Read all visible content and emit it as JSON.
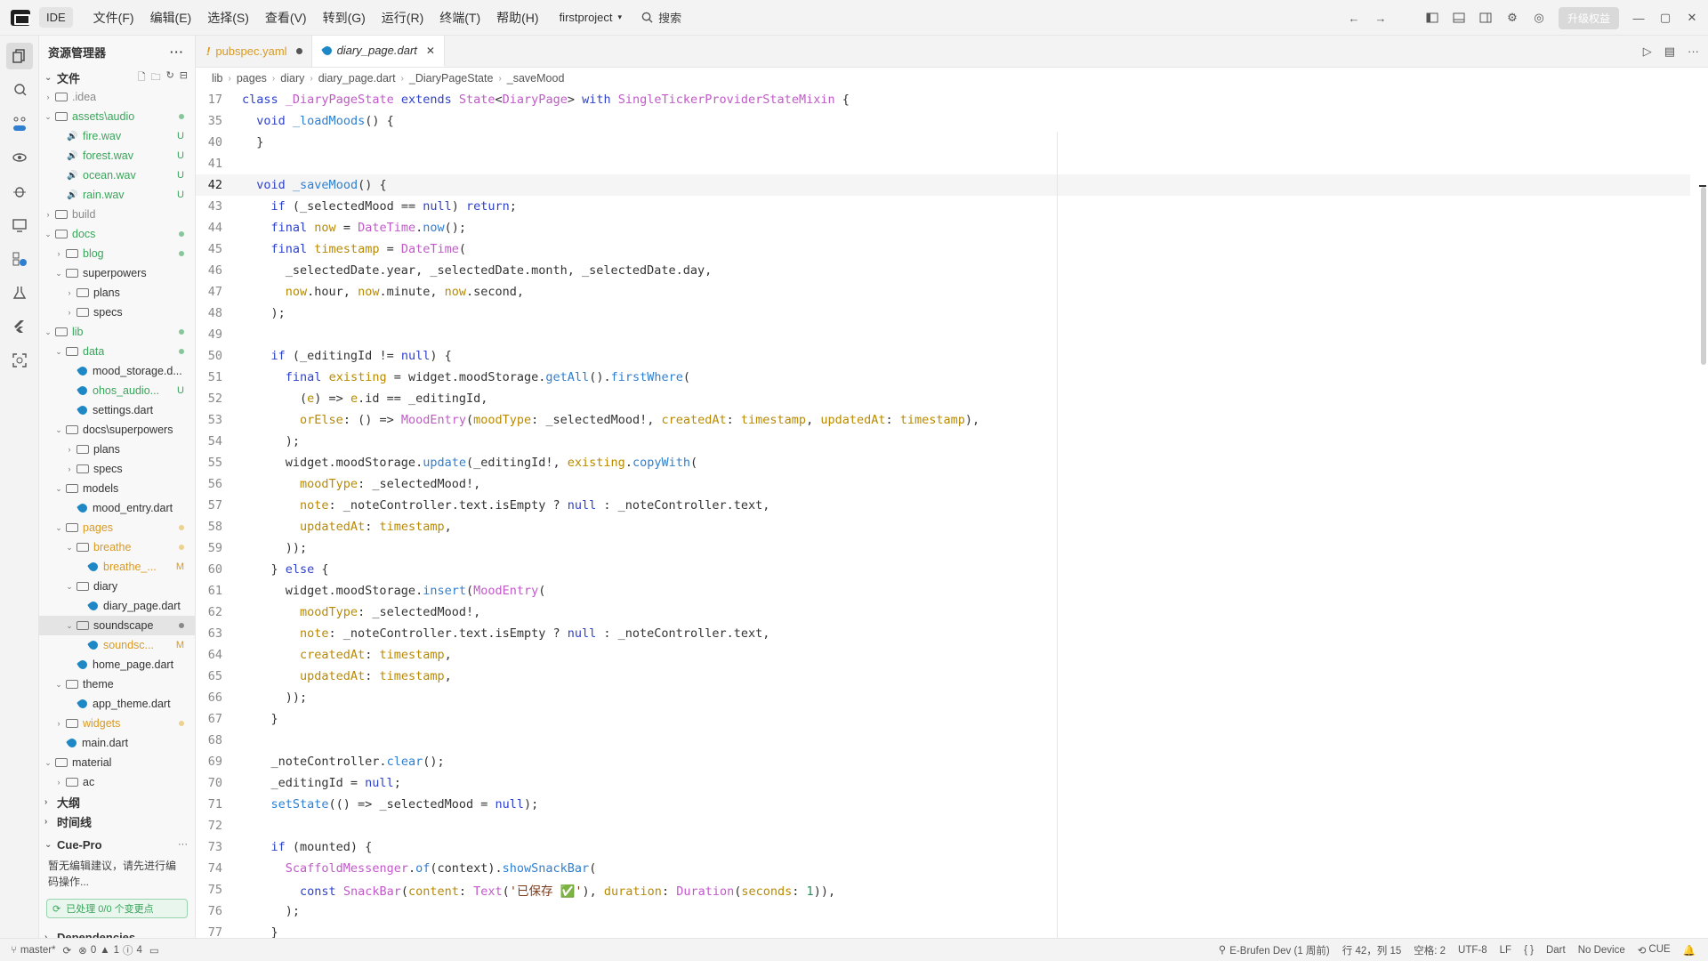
{
  "titlebar": {
    "app": "IDE",
    "menus": [
      "文件(F)",
      "编辑(E)",
      "选择(S)",
      "查看(V)",
      "转到(G)",
      "运行(R)",
      "终端(T)",
      "帮助(H)"
    ],
    "project": "firstproject",
    "search": "搜索",
    "upgrade": "升级权益"
  },
  "sidebar": {
    "title": "资源管理器",
    "files_section": "文件",
    "tree": [
      {
        "depth": 0,
        "type": "folder",
        "label": ".idea",
        "open": false,
        "color": "gray"
      },
      {
        "depth": 0,
        "type": "folder",
        "label": "assets\\audio",
        "open": true,
        "color": "green",
        "dot": "green"
      },
      {
        "depth": 1,
        "type": "wav",
        "label": "fire.wav",
        "color": "green",
        "badge": "U"
      },
      {
        "depth": 1,
        "type": "wav",
        "label": "forest.wav",
        "color": "green",
        "badge": "U"
      },
      {
        "depth": 1,
        "type": "wav",
        "label": "ocean.wav",
        "color": "green",
        "badge": "U"
      },
      {
        "depth": 1,
        "type": "wav",
        "label": "rain.wav",
        "color": "green",
        "badge": "U"
      },
      {
        "depth": 0,
        "type": "folder",
        "label": "build",
        "open": false,
        "color": "gray"
      },
      {
        "depth": 0,
        "type": "folder",
        "label": "docs",
        "open": true,
        "color": "green",
        "dot": "green"
      },
      {
        "depth": 1,
        "type": "folder",
        "label": "blog",
        "open": false,
        "color": "green",
        "dot": "green"
      },
      {
        "depth": 1,
        "type": "folder",
        "label": "superpowers",
        "open": true,
        "color": "default"
      },
      {
        "depth": 2,
        "type": "folder",
        "label": "plans",
        "open": false,
        "color": "default"
      },
      {
        "depth": 2,
        "type": "folder",
        "label": "specs",
        "open": false,
        "color": "default"
      },
      {
        "depth": 0,
        "type": "folder",
        "label": "lib",
        "open": true,
        "color": "green",
        "dot": "green"
      },
      {
        "depth": 1,
        "type": "folder",
        "label": "data",
        "open": true,
        "color": "green",
        "dot": "green"
      },
      {
        "depth": 2,
        "type": "dart",
        "label": "mood_storage.d...",
        "color": "default"
      },
      {
        "depth": 2,
        "type": "dart",
        "label": "ohos_audio...",
        "color": "green",
        "badge": "U"
      },
      {
        "depth": 2,
        "type": "dart",
        "label": "settings.dart",
        "color": "default"
      },
      {
        "depth": 1,
        "type": "folder",
        "label": "docs\\superpowers",
        "open": true,
        "color": "default"
      },
      {
        "depth": 2,
        "type": "folder",
        "label": "plans",
        "open": false,
        "color": "default"
      },
      {
        "depth": 2,
        "type": "folder",
        "label": "specs",
        "open": false,
        "color": "default"
      },
      {
        "depth": 1,
        "type": "folder",
        "label": "models",
        "open": true,
        "color": "default"
      },
      {
        "depth": 2,
        "type": "dart",
        "label": "mood_entry.dart",
        "color": "default"
      },
      {
        "depth": 1,
        "type": "folder",
        "label": "pages",
        "open": true,
        "color": "orange",
        "dot": "orange"
      },
      {
        "depth": 2,
        "type": "folder",
        "label": "breathe",
        "open": true,
        "color": "orange",
        "dot": "orange"
      },
      {
        "depth": 3,
        "type": "dart",
        "label": "breathe_...",
        "color": "orange",
        "badge": "M"
      },
      {
        "depth": 2,
        "type": "folder",
        "label": "diary",
        "open": true,
        "color": "default"
      },
      {
        "depth": 3,
        "type": "dart",
        "label": "diary_page.dart",
        "color": "default"
      },
      {
        "depth": 2,
        "type": "folder",
        "label": "soundscape",
        "open": true,
        "color": "default",
        "dot": "gray",
        "selected": true
      },
      {
        "depth": 3,
        "type": "dart",
        "label": "soundsc...",
        "color": "orange",
        "badge": "M"
      },
      {
        "depth": 2,
        "type": "dart",
        "label": "home_page.dart",
        "color": "default"
      },
      {
        "depth": 1,
        "type": "folder",
        "label": "theme",
        "open": true,
        "color": "default"
      },
      {
        "depth": 2,
        "type": "dart",
        "label": "app_theme.dart",
        "color": "default"
      },
      {
        "depth": 1,
        "type": "folder",
        "label": "widgets",
        "open": false,
        "color": "orange",
        "dot": "orange"
      },
      {
        "depth": 1,
        "type": "dart",
        "label": "main.dart",
        "color": "default"
      },
      {
        "depth": 0,
        "type": "folder",
        "label": "material",
        "open": true,
        "color": "default"
      },
      {
        "depth": 1,
        "type": "folder",
        "label": "ac",
        "open": false,
        "color": "default"
      }
    ],
    "outline": "大纲",
    "timeline": "时间线",
    "cue_pro": "Cue-Pro",
    "cue_msg": "暂无编辑建议，请先进行编码操作...",
    "cue_status": "已处理 0/0 个变更点",
    "dependencies": "Dependencies"
  },
  "tabs": [
    {
      "label": "pubspec.yaml",
      "active": false,
      "modified": true
    },
    {
      "label": "diary_page.dart",
      "active": true,
      "modified": false
    }
  ],
  "breadcrumb": [
    "lib",
    "pages",
    "diary",
    "diary_page.dart",
    "_DiaryPageState",
    "_saveMood"
  ],
  "code": [
    {
      "ln": "17",
      "sticky": true,
      "html": "<span class='kw'>class</span> <span class='ty'>_DiaryPageState</span> <span class='kw'>extends</span> <span class='ty'>State</span>&lt;<span class='ty'>DiaryPage</span>&gt; <span class='kw'>with</span> <span class='ty'>SingleTickerProviderStateMixin</span> {"
    },
    {
      "ln": "35",
      "sticky": true,
      "html": "  <span class='kw'>void</span> <span class='fn'>_loadMoods</span>() {"
    },
    {
      "ln": "40",
      "html": "  }"
    },
    {
      "ln": "41",
      "html": ""
    },
    {
      "ln": "42",
      "cur": true,
      "html": "  <span class='kw'>void</span> <span class='fn'>_saveMood</span>() {"
    },
    {
      "ln": "43",
      "html": "    <span class='kw'>if</span> (_selectedMood == <span class='kw'>null</span>) <span class='kw'>return</span>;"
    },
    {
      "ln": "44",
      "html": "    <span class='kw'>final</span> <span class='pr'>now</span> = <span class='ty'>DateTime</span>.<span class='fn'>now</span>();"
    },
    {
      "ln": "45",
      "html": "    <span class='kw'>final</span> <span class='pr'>timestamp</span> = <span class='ty'>DateTime</span>("
    },
    {
      "ln": "46",
      "html": "      _selectedDate.year, _selectedDate.month, _selectedDate.day,"
    },
    {
      "ln": "47",
      "html": "      <span class='pr'>now</span>.hour, <span class='pr'>now</span>.minute, <span class='pr'>now</span>.second,"
    },
    {
      "ln": "48",
      "html": "    );"
    },
    {
      "ln": "49",
      "html": ""
    },
    {
      "ln": "50",
      "html": "    <span class='kw'>if</span> (_editingId != <span class='kw'>null</span>) {"
    },
    {
      "ln": "51",
      "html": "      <span class='kw'>final</span> <span class='pr'>existing</span> = widget.moodStorage.<span class='fn'>getAll</span>().<span class='fn'>firstWhere</span>("
    },
    {
      "ln": "52",
      "html": "        (<span class='pr'>e</span>) =&gt; <span class='pr'>e</span>.id == _editingId,"
    },
    {
      "ln": "53",
      "html": "        <span class='pr'>orElse</span>: () =&gt; <span class='ty'>MoodEntry</span>(<span class='pr'>moodType</span>: _selectedMood!, <span class='pr'>createdAt</span>: <span class='pr'>timestamp</span>, <span class='pr'>updatedAt</span>: <span class='pr'>timestamp</span>),"
    },
    {
      "ln": "54",
      "html": "      );"
    },
    {
      "ln": "55",
      "html": "      widget.moodStorage.<span class='fn'>update</span>(_editingId!, <span class='pr'>existing</span>.<span class='fn'>copyWith</span>("
    },
    {
      "ln": "56",
      "html": "        <span class='pr'>moodType</span>: _selectedMood!,"
    },
    {
      "ln": "57",
      "html": "        <span class='pr'>note</span>: _noteController.text.isEmpty ? <span class='kw'>null</span> : _noteController.text,"
    },
    {
      "ln": "58",
      "html": "        <span class='pr'>updatedAt</span>: <span class='pr'>timestamp</span>,"
    },
    {
      "ln": "59",
      "html": "      ));"
    },
    {
      "ln": "60",
      "html": "    } <span class='kw'>else</span> {"
    },
    {
      "ln": "61",
      "html": "      widget.moodStorage.<span class='fn'>insert</span>(<span class='ty'>MoodEntry</span>("
    },
    {
      "ln": "62",
      "html": "        <span class='pr'>moodType</span>: _selectedMood!,"
    },
    {
      "ln": "63",
      "html": "        <span class='pr'>note</span>: _noteController.text.isEmpty ? <span class='kw'>null</span> : _noteController.text,"
    },
    {
      "ln": "64",
      "html": "        <span class='pr'>createdAt</span>: <span class='pr'>timestamp</span>,"
    },
    {
      "ln": "65",
      "html": "        <span class='pr'>updatedAt</span>: <span class='pr'>timestamp</span>,"
    },
    {
      "ln": "66",
      "html": "      ));"
    },
    {
      "ln": "67",
      "html": "    }"
    },
    {
      "ln": "68",
      "html": ""
    },
    {
      "ln": "69",
      "html": "    _noteController.<span class='fn'>clear</span>();"
    },
    {
      "ln": "70",
      "html": "    _editingId = <span class='kw'>null</span>;"
    },
    {
      "ln": "71",
      "html": "    <span class='fn'>setState</span>(() =&gt; _selectedMood = <span class='kw'>null</span>);"
    },
    {
      "ln": "72",
      "html": ""
    },
    {
      "ln": "73",
      "html": "    <span class='kw'>if</span> (mounted) {"
    },
    {
      "ln": "74",
      "html": "      <span class='ty'>ScaffoldMessenger</span>.<span class='fn'>of</span>(context).<span class='fn'>showSnackBar</span>("
    },
    {
      "ln": "75",
      "html": "        <span class='kw'>const</span> <span class='ty'>SnackBar</span>(<span class='pr'>content</span>: <span class='ty'>Text</span>(<span class='str'>'已保存 ✅'</span>), <span class='pr'>duration</span>: <span class='ty'>Duration</span>(<span class='pr'>seconds</span>: <span class='num'>1</span>)),"
    },
    {
      "ln": "76",
      "html": "      );"
    },
    {
      "ln": "77",
      "html": "    }"
    }
  ],
  "statusbar": {
    "branch": "master*",
    "errors": "0",
    "warnings": "1",
    "info": "4",
    "device_config": "E-Brufen Dev (1 周前)",
    "position": "行 42，列 15",
    "spaces": "空格: 2",
    "encoding": "UTF-8",
    "eol": "LF",
    "braces": "{ }",
    "language": "Dart",
    "device": "No Device",
    "cue": "CUE"
  }
}
